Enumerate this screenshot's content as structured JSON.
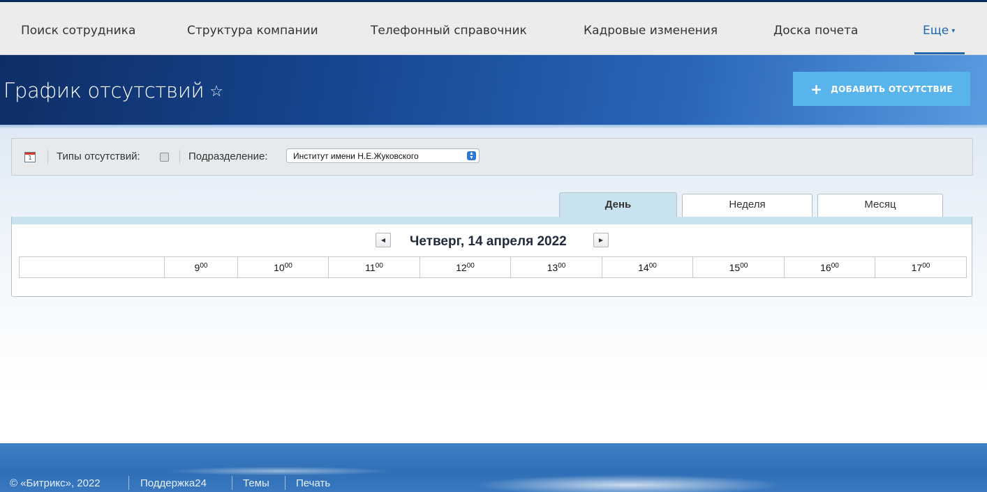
{
  "nav": {
    "items": [
      "Поиск сотрудника",
      "Структура компании",
      "Телефонный справочник",
      "Кадровые изменения",
      "Доска почета"
    ],
    "more": "Еще"
  },
  "header": {
    "title": "График отсутствий",
    "add_button": "ДОБАВИТЬ ОТСУТСТВИЕ"
  },
  "filter": {
    "calendar_day": "1",
    "absence_types_label": "Типы отсутствий:",
    "department_label": "Подразделение:",
    "department_value": "Институт имени Н.Е.Жуковского"
  },
  "tabs": [
    {
      "label": "День",
      "active": true
    },
    {
      "label": "Неделя",
      "active": false
    },
    {
      "label": "Месяц",
      "active": false
    }
  ],
  "calendar": {
    "date_title": "Четверг, 14 апреля 2022",
    "hours": [
      "9",
      "10",
      "11",
      "12",
      "13",
      "14",
      "15",
      "16",
      "17"
    ],
    "minutes": "00"
  },
  "footer": {
    "copyright": "© «Битрикс», 2022",
    "links": [
      "Поддержка24",
      "Темы",
      "Печать"
    ]
  },
  "colors": {
    "accent": "#2067b0",
    "add_button": "#58b4ea",
    "tab_active": "#c9e2ef"
  }
}
